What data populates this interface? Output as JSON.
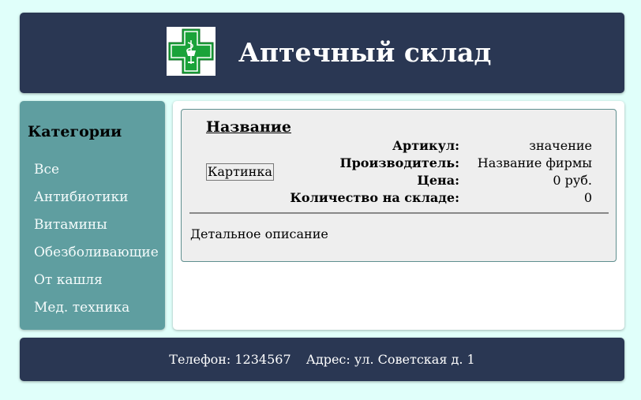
{
  "header": {
    "title": "Аптечный склад",
    "logo_icon": "pharmacy-cross-icon",
    "logo_colors": {
      "cross": "#1aa33a",
      "outline": "#ffffff",
      "background": "#ffffff"
    }
  },
  "sidebar": {
    "title": "Категории",
    "items": [
      {
        "label": "Все"
      },
      {
        "label": "Антибиотики"
      },
      {
        "label": "Витамины"
      },
      {
        "label": "Обезболивающие"
      },
      {
        "label": "От кашля"
      },
      {
        "label": "Мед. техника"
      }
    ]
  },
  "product": {
    "name": "Название",
    "image_alt": "Картинка",
    "specs": [
      {
        "label": "Артикул:",
        "value": "значение"
      },
      {
        "label": "Производитель:",
        "value": "Название фирмы"
      },
      {
        "label": "Цена:",
        "value": "0 руб."
      },
      {
        "label": "Количество на складе:",
        "value": "0"
      }
    ],
    "description": "Детальное описание"
  },
  "footer": {
    "phone_label": "Телефон:",
    "phone": "1234567",
    "address_label": "Адрес:",
    "address": "ул. Советская д. 1"
  },
  "colors": {
    "page_background": "#e0fffa",
    "header_footer": "#2a3753",
    "sidebar": "#5f9ea0",
    "card": "#eeeeee"
  }
}
